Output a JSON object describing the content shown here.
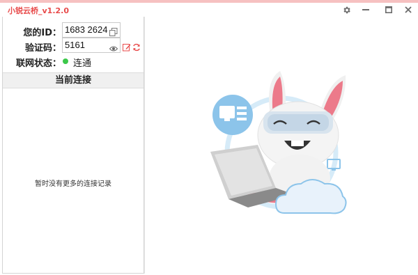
{
  "window": {
    "title": "小锐云桥_v1.2.0"
  },
  "titlebar": {
    "settings_icon": "gear-icon",
    "minimize_icon": "minimize-icon",
    "maximize_icon": "maximize-icon",
    "close_icon": "close-icon"
  },
  "connection": {
    "id_label": "您的ID：",
    "id_value": "1683 2624",
    "code_label": "验证码：",
    "code_value": "5161",
    "status_label": "联网状态：",
    "status_value": "连通",
    "status_color": "#3cc84a"
  },
  "current": {
    "header": "当前连接",
    "empty_text": "暂时没有更多的连接记录"
  },
  "colors": {
    "accent": "#e84a4a",
    "title_bar_strip": "#f6c1c1",
    "illustration_blue": "#8cc4ea",
    "rabbit_ear_pink": "#ec7a8a"
  }
}
